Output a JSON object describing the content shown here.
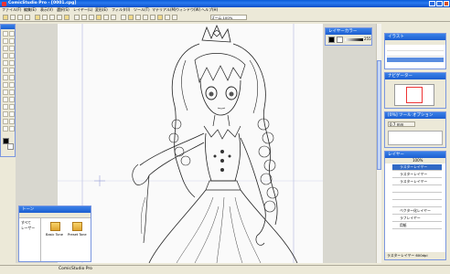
{
  "window": {
    "title": "ComicStudio Pro - [0001.cpg]"
  },
  "menu": [
    "ファイル(F)",
    "編集(E)",
    "表示(V)",
    "選択(S)",
    "レイヤー(L)",
    "変形(E)",
    "フィルタ(I)",
    "ツール(T)",
    "マテリアル(M)",
    "ウィンドウ(W)",
    "ヘルプ(H)"
  ],
  "palettes": {
    "layer_color": {
      "title": "レイヤーカラー",
      "value": "255"
    },
    "tone": {
      "title": "トーン",
      "items": [
        {
          "label": "すべて",
          "kind": "folder"
        },
        {
          "label": "レーザー",
          "kind": "folder"
        },
        {
          "label": "Basic Tone",
          "kind": "tone"
        },
        {
          "label": "Preset Tone",
          "kind": "tone"
        }
      ]
    },
    "illust": {
      "title": "イラスト"
    },
    "navigator": {
      "title": "ナビゲーター"
    },
    "tool_option": {
      "title": "[0%] ツール オプション",
      "value": "0.7 mm"
    },
    "layer": {
      "title": "レイヤー",
      "opacity": "100%",
      "rows": [
        {
          "label": "ラスターレイヤー",
          "selected": true
        },
        {
          "label": "ラスターレイヤー",
          "selected": false
        },
        {
          "label": "ラスターレイヤー",
          "selected": false
        },
        {
          "label": "",
          "selected": false
        },
        {
          "label": "",
          "selected": false
        },
        {
          "label": "",
          "selected": false
        },
        {
          "label": "ベクター化レイヤー",
          "selected": false
        },
        {
          "label": "ラフレイヤー",
          "selected": false
        },
        {
          "label": "用紙",
          "selected": false
        }
      ],
      "footer": "ラスターレイヤー 600dpi"
    }
  },
  "statusbar": {
    "text": "ComicStudio Pro"
  },
  "zoom": "ズーム 100%"
}
